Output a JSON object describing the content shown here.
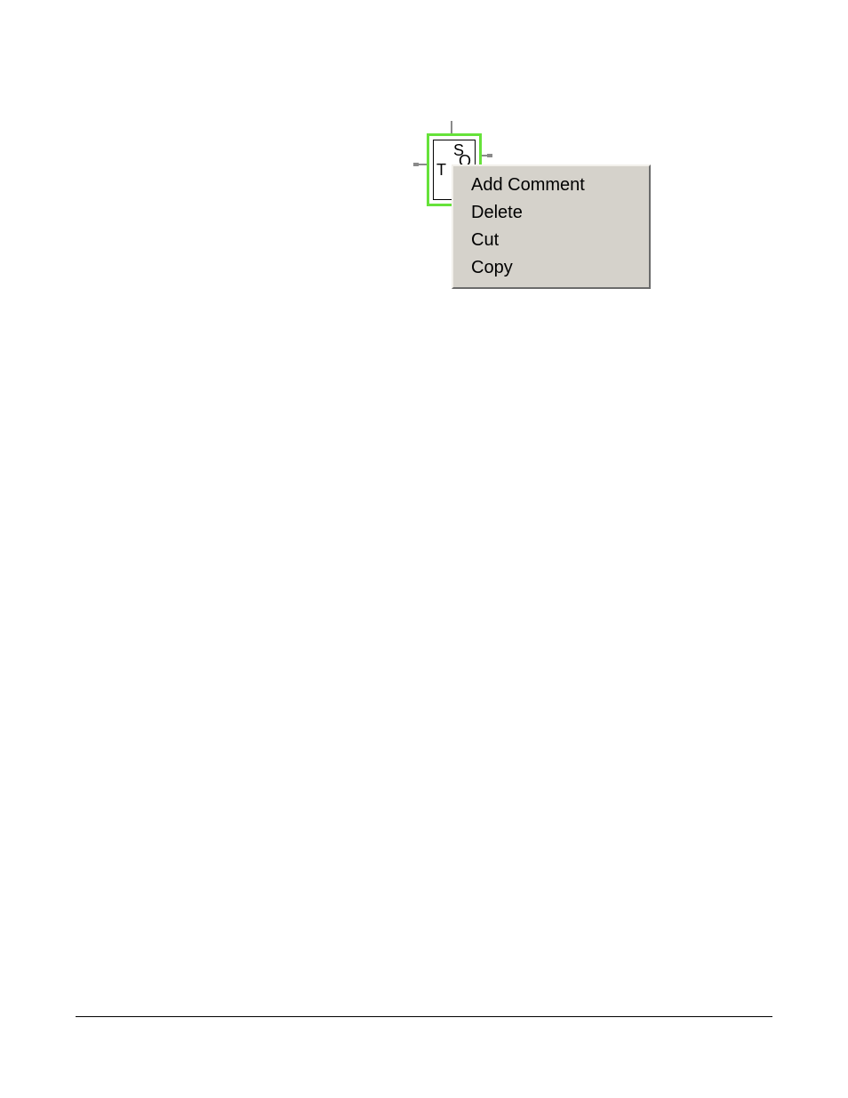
{
  "component": {
    "labels": {
      "s": "S",
      "q": "Q",
      "t": "T"
    }
  },
  "context_menu": {
    "items": [
      "Add Comment",
      "Delete",
      "Cut",
      "Copy"
    ]
  }
}
